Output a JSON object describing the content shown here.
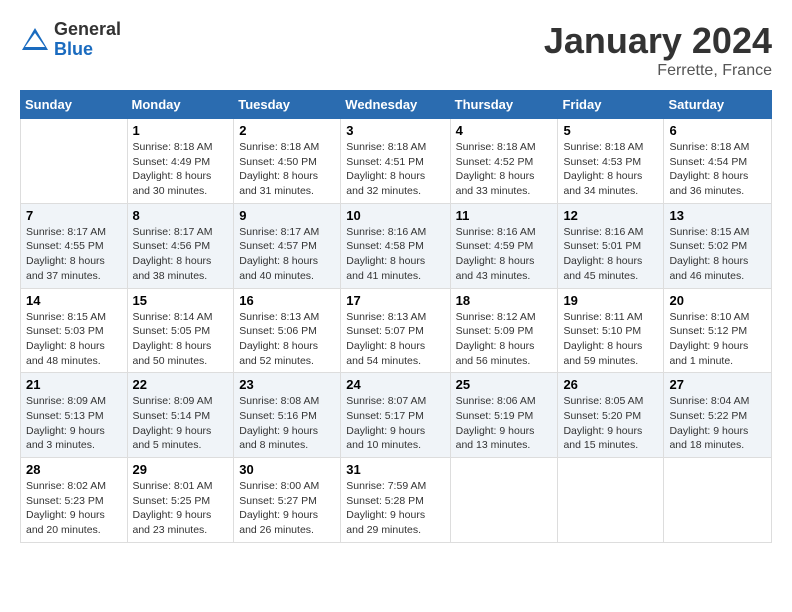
{
  "header": {
    "logo_general": "General",
    "logo_blue": "Blue",
    "month_title": "January 2024",
    "location": "Ferrette, France"
  },
  "columns": [
    "Sunday",
    "Monday",
    "Tuesday",
    "Wednesday",
    "Thursday",
    "Friday",
    "Saturday"
  ],
  "weeks": [
    [
      {
        "day": "",
        "sunrise": "",
        "sunset": "",
        "daylight": ""
      },
      {
        "day": "1",
        "sunrise": "Sunrise: 8:18 AM",
        "sunset": "Sunset: 4:49 PM",
        "daylight": "Daylight: 8 hours and 30 minutes."
      },
      {
        "day": "2",
        "sunrise": "Sunrise: 8:18 AM",
        "sunset": "Sunset: 4:50 PM",
        "daylight": "Daylight: 8 hours and 31 minutes."
      },
      {
        "day": "3",
        "sunrise": "Sunrise: 8:18 AM",
        "sunset": "Sunset: 4:51 PM",
        "daylight": "Daylight: 8 hours and 32 minutes."
      },
      {
        "day": "4",
        "sunrise": "Sunrise: 8:18 AM",
        "sunset": "Sunset: 4:52 PM",
        "daylight": "Daylight: 8 hours and 33 minutes."
      },
      {
        "day": "5",
        "sunrise": "Sunrise: 8:18 AM",
        "sunset": "Sunset: 4:53 PM",
        "daylight": "Daylight: 8 hours and 34 minutes."
      },
      {
        "day": "6",
        "sunrise": "Sunrise: 8:18 AM",
        "sunset": "Sunset: 4:54 PM",
        "daylight": "Daylight: 8 hours and 36 minutes."
      }
    ],
    [
      {
        "day": "7",
        "sunrise": "Sunrise: 8:17 AM",
        "sunset": "Sunset: 4:55 PM",
        "daylight": "Daylight: 8 hours and 37 minutes."
      },
      {
        "day": "8",
        "sunrise": "Sunrise: 8:17 AM",
        "sunset": "Sunset: 4:56 PM",
        "daylight": "Daylight: 8 hours and 38 minutes."
      },
      {
        "day": "9",
        "sunrise": "Sunrise: 8:17 AM",
        "sunset": "Sunset: 4:57 PM",
        "daylight": "Daylight: 8 hours and 40 minutes."
      },
      {
        "day": "10",
        "sunrise": "Sunrise: 8:16 AM",
        "sunset": "Sunset: 4:58 PM",
        "daylight": "Daylight: 8 hours and 41 minutes."
      },
      {
        "day": "11",
        "sunrise": "Sunrise: 8:16 AM",
        "sunset": "Sunset: 4:59 PM",
        "daylight": "Daylight: 8 hours and 43 minutes."
      },
      {
        "day": "12",
        "sunrise": "Sunrise: 8:16 AM",
        "sunset": "Sunset: 5:01 PM",
        "daylight": "Daylight: 8 hours and 45 minutes."
      },
      {
        "day": "13",
        "sunrise": "Sunrise: 8:15 AM",
        "sunset": "Sunset: 5:02 PM",
        "daylight": "Daylight: 8 hours and 46 minutes."
      }
    ],
    [
      {
        "day": "14",
        "sunrise": "Sunrise: 8:15 AM",
        "sunset": "Sunset: 5:03 PM",
        "daylight": "Daylight: 8 hours and 48 minutes."
      },
      {
        "day": "15",
        "sunrise": "Sunrise: 8:14 AM",
        "sunset": "Sunset: 5:05 PM",
        "daylight": "Daylight: 8 hours and 50 minutes."
      },
      {
        "day": "16",
        "sunrise": "Sunrise: 8:13 AM",
        "sunset": "Sunset: 5:06 PM",
        "daylight": "Daylight: 8 hours and 52 minutes."
      },
      {
        "day": "17",
        "sunrise": "Sunrise: 8:13 AM",
        "sunset": "Sunset: 5:07 PM",
        "daylight": "Daylight: 8 hours and 54 minutes."
      },
      {
        "day": "18",
        "sunrise": "Sunrise: 8:12 AM",
        "sunset": "Sunset: 5:09 PM",
        "daylight": "Daylight: 8 hours and 56 minutes."
      },
      {
        "day": "19",
        "sunrise": "Sunrise: 8:11 AM",
        "sunset": "Sunset: 5:10 PM",
        "daylight": "Daylight: 8 hours and 59 minutes."
      },
      {
        "day": "20",
        "sunrise": "Sunrise: 8:10 AM",
        "sunset": "Sunset: 5:12 PM",
        "daylight": "Daylight: 9 hours and 1 minute."
      }
    ],
    [
      {
        "day": "21",
        "sunrise": "Sunrise: 8:09 AM",
        "sunset": "Sunset: 5:13 PM",
        "daylight": "Daylight: 9 hours and 3 minutes."
      },
      {
        "day": "22",
        "sunrise": "Sunrise: 8:09 AM",
        "sunset": "Sunset: 5:14 PM",
        "daylight": "Daylight: 9 hours and 5 minutes."
      },
      {
        "day": "23",
        "sunrise": "Sunrise: 8:08 AM",
        "sunset": "Sunset: 5:16 PM",
        "daylight": "Daylight: 9 hours and 8 minutes."
      },
      {
        "day": "24",
        "sunrise": "Sunrise: 8:07 AM",
        "sunset": "Sunset: 5:17 PM",
        "daylight": "Daylight: 9 hours and 10 minutes."
      },
      {
        "day": "25",
        "sunrise": "Sunrise: 8:06 AM",
        "sunset": "Sunset: 5:19 PM",
        "daylight": "Daylight: 9 hours and 13 minutes."
      },
      {
        "day": "26",
        "sunrise": "Sunrise: 8:05 AM",
        "sunset": "Sunset: 5:20 PM",
        "daylight": "Daylight: 9 hours and 15 minutes."
      },
      {
        "day": "27",
        "sunrise": "Sunrise: 8:04 AM",
        "sunset": "Sunset: 5:22 PM",
        "daylight": "Daylight: 9 hours and 18 minutes."
      }
    ],
    [
      {
        "day": "28",
        "sunrise": "Sunrise: 8:02 AM",
        "sunset": "Sunset: 5:23 PM",
        "daylight": "Daylight: 9 hours and 20 minutes."
      },
      {
        "day": "29",
        "sunrise": "Sunrise: 8:01 AM",
        "sunset": "Sunset: 5:25 PM",
        "daylight": "Daylight: 9 hours and 23 minutes."
      },
      {
        "day": "30",
        "sunrise": "Sunrise: 8:00 AM",
        "sunset": "Sunset: 5:27 PM",
        "daylight": "Daylight: 9 hours and 26 minutes."
      },
      {
        "day": "31",
        "sunrise": "Sunrise: 7:59 AM",
        "sunset": "Sunset: 5:28 PM",
        "daylight": "Daylight: 9 hours and 29 minutes."
      },
      {
        "day": "",
        "sunrise": "",
        "sunset": "",
        "daylight": ""
      },
      {
        "day": "",
        "sunrise": "",
        "sunset": "",
        "daylight": ""
      },
      {
        "day": "",
        "sunrise": "",
        "sunset": "",
        "daylight": ""
      }
    ]
  ]
}
